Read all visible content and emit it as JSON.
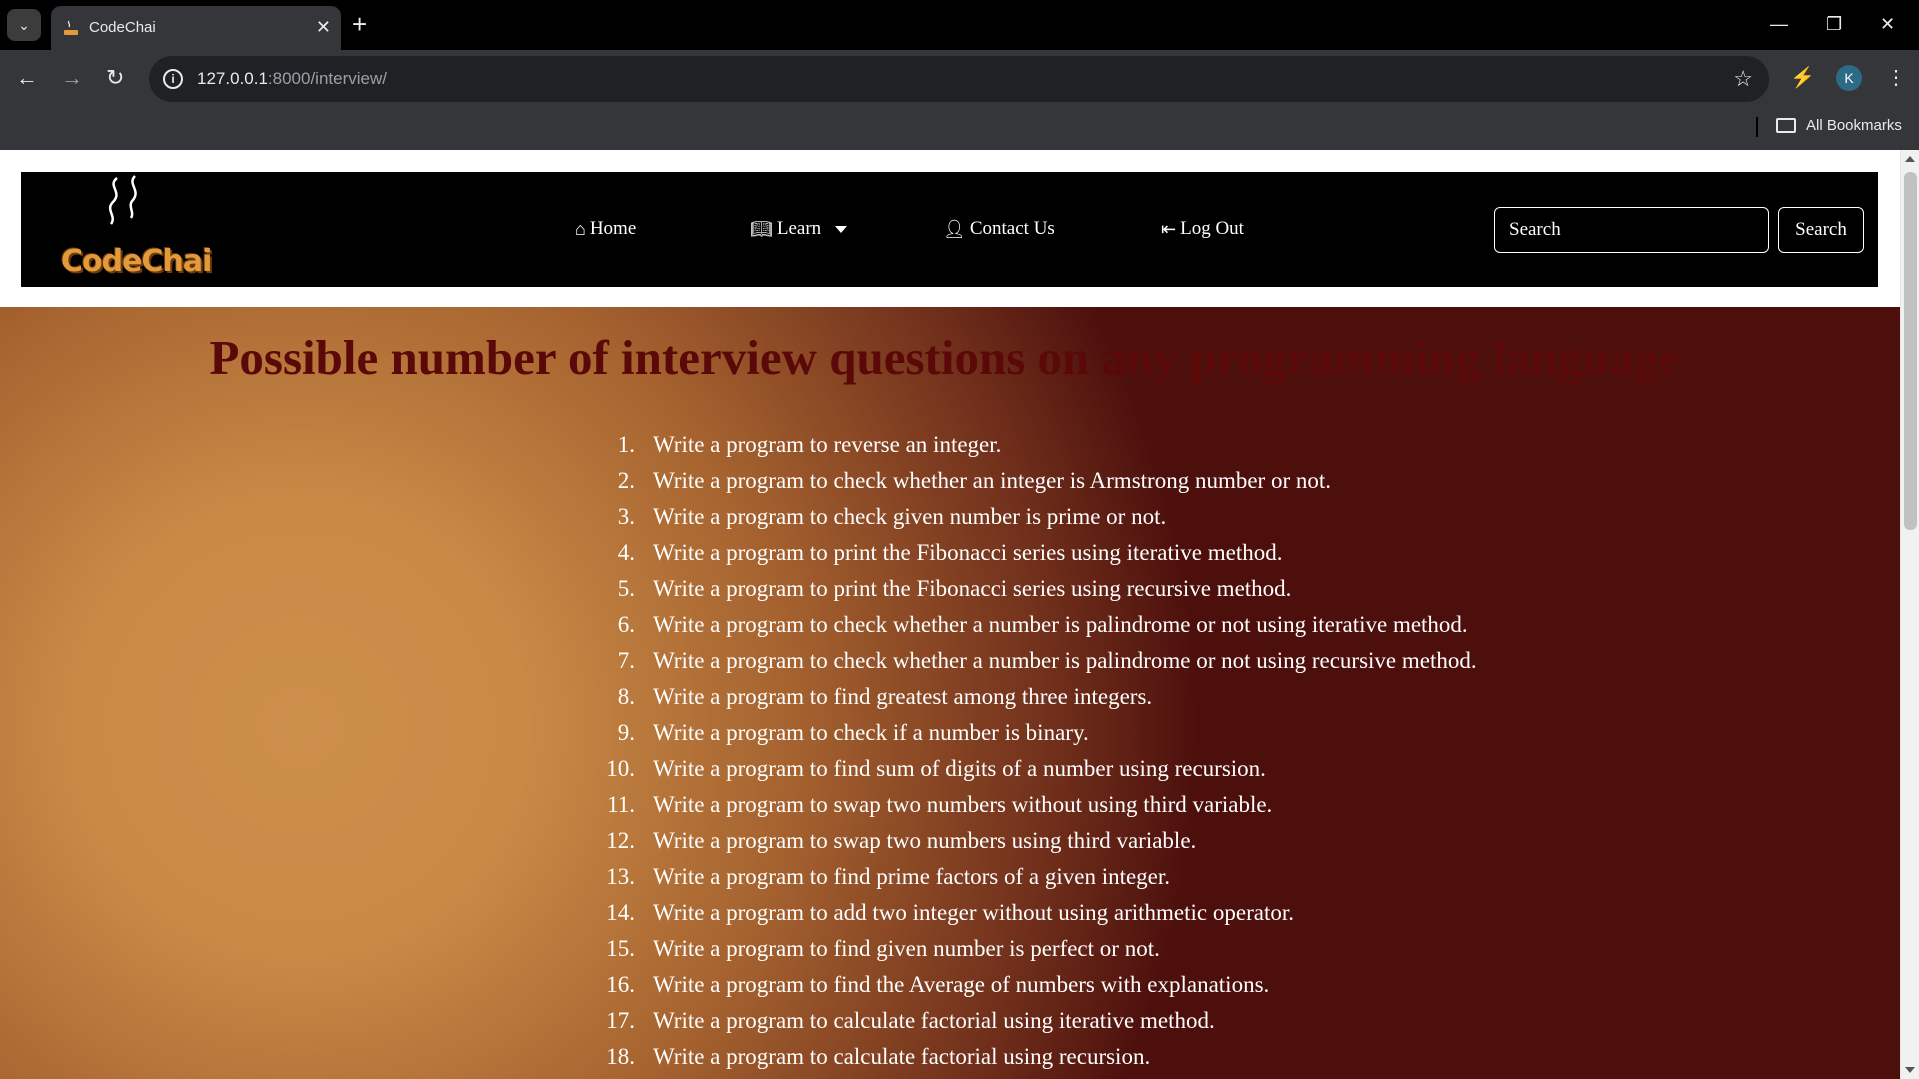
{
  "browser": {
    "tab_title": "CodeChai",
    "url_host": "127.0.0.1",
    "url_path": ":8000/interview/",
    "bookmarks_label": "All Bookmarks",
    "profile_initial": "K"
  },
  "navbar": {
    "logo_text": "CodeChai",
    "links": [
      {
        "label": "Home",
        "icon": "home-icon"
      },
      {
        "label": "Learn",
        "icon": "book-icon"
      },
      {
        "label": "Contact Us",
        "icon": "contact-icon"
      },
      {
        "label": "Log Out",
        "icon": "logout-icon"
      }
    ],
    "search_placeholder": "Search",
    "search_button": "Search"
  },
  "main": {
    "heading": "Possible number of interview questions on any programming language",
    "questions": [
      {
        "num": "1.",
        "text": "Write a program to reverse an integer."
      },
      {
        "num": "2.",
        "text": "Write a program to check whether an integer is Armstrong number or not."
      },
      {
        "num": "3.",
        "text": "Write a program to check given number is prime or not."
      },
      {
        "num": "4.",
        "text": "Write a program to print the Fibonacci series using iterative method."
      },
      {
        "num": "5.",
        "text": "Write a program to print the Fibonacci series using recursive method."
      },
      {
        "num": "6.",
        "text": "Write a program to check whether a number is palindrome or not using iterative method."
      },
      {
        "num": "7.",
        "text": "Write a program to check whether a number is palindrome or not using recursive method."
      },
      {
        "num": "8.",
        "text": "Write a program to find greatest among three integers."
      },
      {
        "num": "9.",
        "text": "Write a program to check if a number is binary."
      },
      {
        "num": "10.",
        "text": "Write a program to find sum of digits of a number using recursion."
      },
      {
        "num": "11.",
        "text": "Write a program to swap two numbers without using third variable."
      },
      {
        "num": "12.",
        "text": "Write a program to swap two numbers using third variable."
      },
      {
        "num": "13.",
        "text": "Write a program to find prime factors of a given integer."
      },
      {
        "num": "14.",
        "text": "Write a program to add two integer without using arithmetic operator."
      },
      {
        "num": "15.",
        "text": "Write a program to find given number is perfect or not."
      },
      {
        "num": "16.",
        "text": "Write a program to find the Average of numbers with explanations."
      },
      {
        "num": "17.",
        "text": "Write a program to calculate factorial using iterative method."
      },
      {
        "num": "18.",
        "text": "Write a program to calculate factorial using recursion."
      }
    ]
  }
}
